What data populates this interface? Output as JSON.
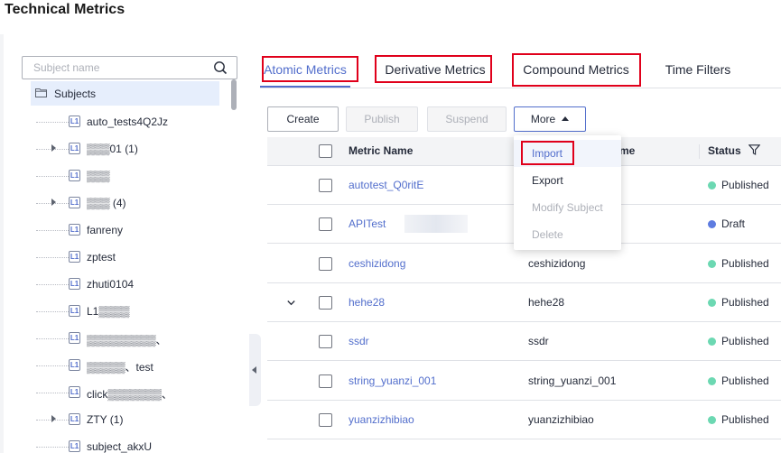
{
  "page": {
    "title": "Technical Metrics"
  },
  "colors": {
    "accent": "#526ecc",
    "highlight": "#e0001b",
    "published": "#6cd8b2",
    "draft": "#5e7ce0"
  },
  "left": {
    "search_placeholder": "Subject name",
    "root_label": "Subjects",
    "nodes": [
      {
        "label": "auto_tests4Q2Jz",
        "expandable": false
      },
      {
        "label": "▒▒▒01 (1)",
        "expandable": true
      },
      {
        "label": "▒▒▒",
        "expandable": false
      },
      {
        "label": "▒▒▒ (4)",
        "expandable": true
      },
      {
        "label": "fanreny",
        "expandable": false
      },
      {
        "label": "zptest",
        "expandable": false
      },
      {
        "label": "zhuti0104",
        "expandable": false
      },
      {
        "label": "L1▒▒▒▒",
        "expandable": false
      },
      {
        "label": "▒▒▒▒▒▒▒▒▒、",
        "expandable": false
      },
      {
        "label": "▒▒▒▒▒、test",
        "expandable": false
      },
      {
        "label": "click▒▒▒▒▒▒▒、",
        "expandable": false
      },
      {
        "label": "ZTY (1)",
        "expandable": true
      },
      {
        "label": "subject_akxU",
        "expandable": false
      }
    ]
  },
  "tabs": [
    "Atomic Metrics",
    "Derivative Metrics",
    "Compound Metrics",
    "Time Filters"
  ],
  "toolbar": {
    "create": "Create",
    "publish": "Publish",
    "suspend": "Suspend",
    "more": "More"
  },
  "dropdown": {
    "items": [
      "Import",
      "Export",
      "Modify Subject",
      "Delete"
    ]
  },
  "table": {
    "col_name": "Metric Name",
    "col_code": "me",
    "col_status": "Status",
    "rows": [
      {
        "name": "autotest_Q0ritE",
        "code": "",
        "status": "Published"
      },
      {
        "name": "APITest",
        "code": "",
        "status": "Draft"
      },
      {
        "name": "ceshizidong",
        "code": "ceshizidong",
        "status": "Published"
      },
      {
        "name": "hehe28",
        "code": "hehe28",
        "status": "Published"
      },
      {
        "name": "ssdr",
        "code": "ssdr",
        "status": "Published"
      },
      {
        "name": "string_yuanzi_001",
        "code": "string_yuanzi_001",
        "status": "Published"
      },
      {
        "name": "yuanzizhibiao",
        "code": "yuanzizhibiao",
        "status": "Published"
      }
    ]
  }
}
